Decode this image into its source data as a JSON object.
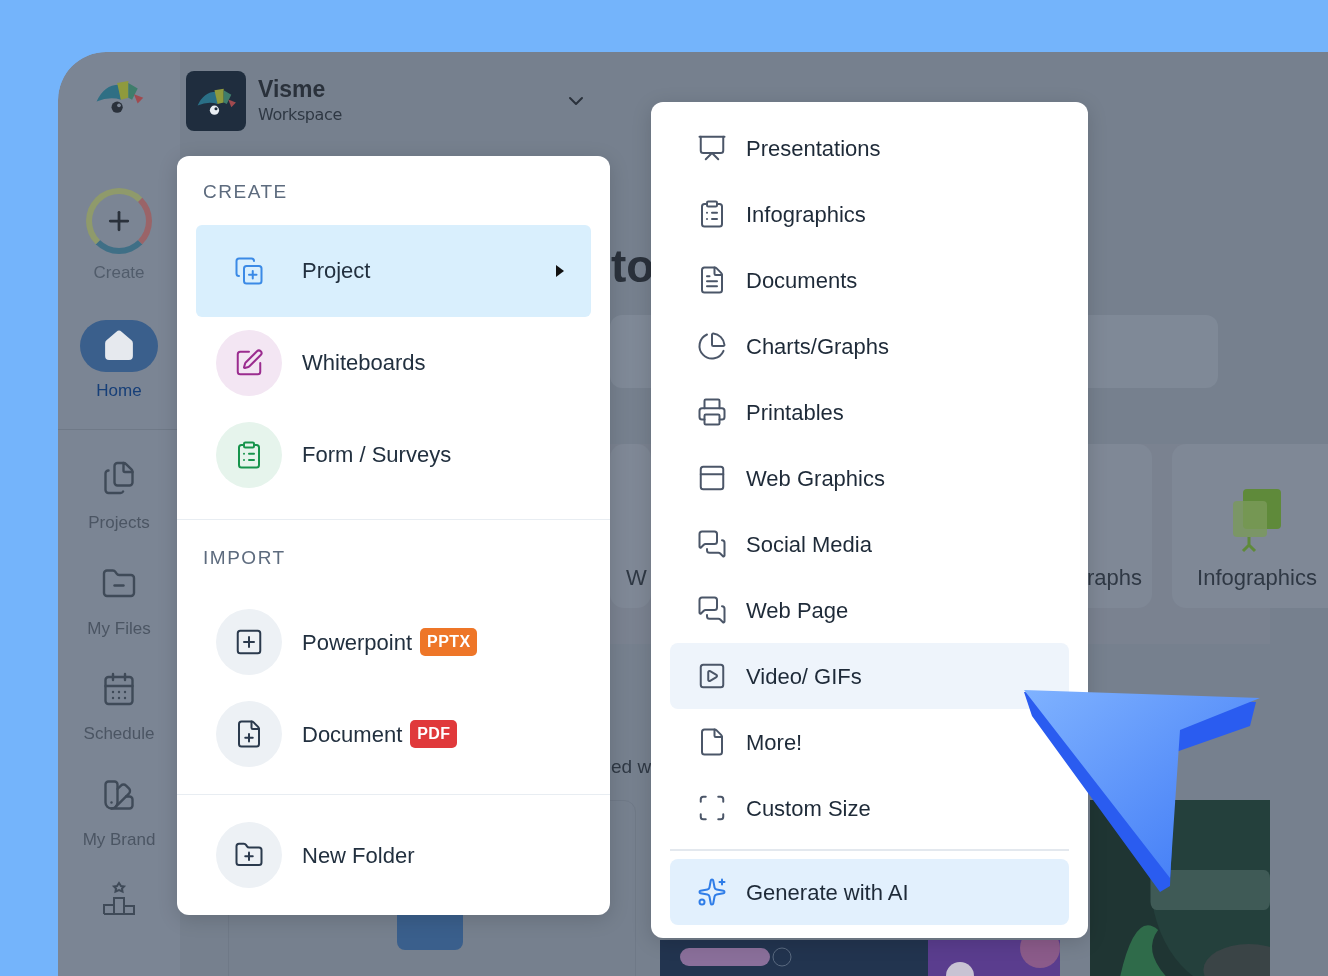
{
  "workspace": {
    "name": "Visme",
    "subtitle": "Workspace"
  },
  "sidebar": {
    "create_label": "Create",
    "items": [
      {
        "label": "Home",
        "selected": true
      },
      {
        "label": "Projects",
        "selected": false
      },
      {
        "label": "My Files",
        "selected": false
      },
      {
        "label": "Schedule",
        "selected": false
      },
      {
        "label": "My Brand",
        "selected": false
      }
    ]
  },
  "background": {
    "heading_fragment": "to",
    "cards": [
      {
        "label": "W"
      },
      {
        "label": "raphs"
      },
      {
        "label": "Infographics"
      }
    ],
    "text_fragment": "ed w"
  },
  "create_menu": {
    "sections": [
      {
        "title": "CREATE",
        "items": [
          {
            "label": "Project",
            "selected": true,
            "has_submenu": true
          },
          {
            "label": "Whiteboards",
            "selected": false,
            "has_submenu": false
          },
          {
            "label": "Form / Surveys",
            "selected": false,
            "has_submenu": false
          }
        ]
      },
      {
        "title": "IMPORT",
        "items": [
          {
            "label": "Powerpoint",
            "selected": false,
            "has_submenu": false,
            "badge": {
              "text": "PPTX",
              "color": "#ee7628"
            }
          },
          {
            "label": "Document",
            "selected": false,
            "has_submenu": false,
            "badge": {
              "text": "PDF",
              "color": "#e0393b"
            }
          }
        ]
      },
      {
        "items": [
          {
            "label": "New Folder",
            "selected": false,
            "has_submenu": false
          }
        ]
      }
    ]
  },
  "project_submenu": {
    "items": [
      {
        "label": "Presentations",
        "kind": "type",
        "selected": false
      },
      {
        "label": "Infographics",
        "kind": "type",
        "selected": false
      },
      {
        "label": "Documents",
        "kind": "type",
        "selected": false
      },
      {
        "label": "Charts/Graphs",
        "kind": "type",
        "selected": false
      },
      {
        "label": "Printables",
        "kind": "type",
        "selected": false
      },
      {
        "label": "Web Graphics",
        "kind": "type",
        "selected": false
      },
      {
        "label": "Social Media",
        "kind": "type",
        "selected": false
      },
      {
        "label": "Web Page",
        "kind": "type",
        "selected": false
      },
      {
        "label": "Video/ GIFs",
        "kind": "type",
        "selected": true
      },
      {
        "label": "More!",
        "kind": "type",
        "selected": false
      },
      {
        "label": "Custom Size",
        "kind": "type",
        "selected": false
      },
      {
        "label": "Generate with AI",
        "kind": "ai",
        "selected": false
      }
    ]
  }
}
